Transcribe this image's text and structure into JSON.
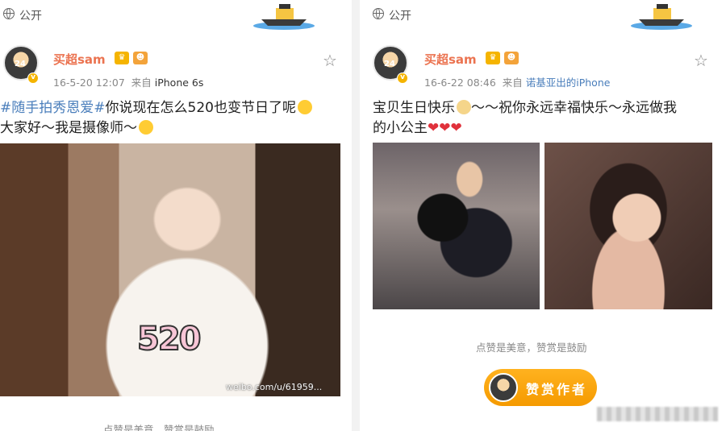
{
  "left_post": {
    "visibility": "公开",
    "username": "买超sam",
    "timestamp": "16-5-20 12:07",
    "source_prefix": "来自",
    "device": "iPhone 6s",
    "topic": "#随手拍秀恩爱#",
    "text_line1": "你说现在怎么520也变节日了呢",
    "text_line2": "大家好～我是摄像师～",
    "image_overlay_text": "520",
    "image_watermark": "weibo.com/u/61959...",
    "footer_hint": "点赞是美意，赞赏是鼓励"
  },
  "right_post": {
    "visibility": "公开",
    "username": "买超sam",
    "timestamp": "16-6-22 08:46",
    "source_prefix": "来自",
    "device": "诺基亚出的iPhone",
    "text_line1": "宝贝生日快乐",
    "text_line1_cont": "～～祝你永远幸福快乐～永远做我",
    "text_line2": "的小公主",
    "hearts": "❤❤❤",
    "footer_hint": "点赞是美意，赞赏是鼓励",
    "reward_button_label": "赞赏作者"
  },
  "icons": {
    "globe": "globe-icon",
    "boat": "boat-icon",
    "star": "star-icon",
    "crown": "vip-crown-icon",
    "verified": "verified-badge-icon"
  },
  "colors": {
    "username": "#eb7350",
    "link": "#4a7ebb",
    "reward": "#f59a00",
    "heart": "#e0313b"
  }
}
